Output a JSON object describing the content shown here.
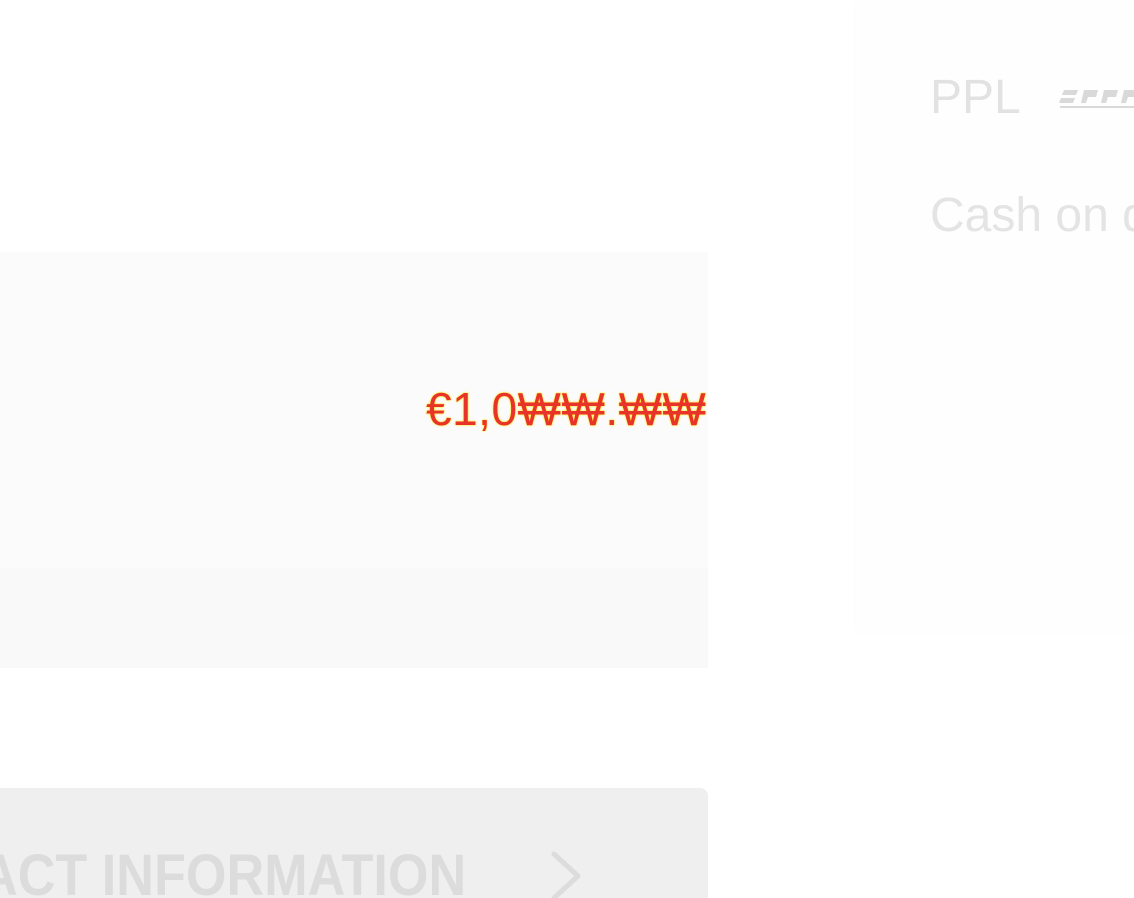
{
  "order_summary": {
    "total": "€1,0₩₩.₩₩"
  },
  "contact": {
    "label": "ACT INFORMATION"
  },
  "shipping": {
    "carrier_label": "PPL",
    "carrier_logo_icon": "ppl-logo-icon"
  },
  "payment": {
    "method_label": "Cash on d"
  },
  "colors": {
    "total_text": "#e8332a",
    "total_glow": "#ffe600",
    "button_bg": "#efefef",
    "muted_text": "#e2e2e2"
  }
}
